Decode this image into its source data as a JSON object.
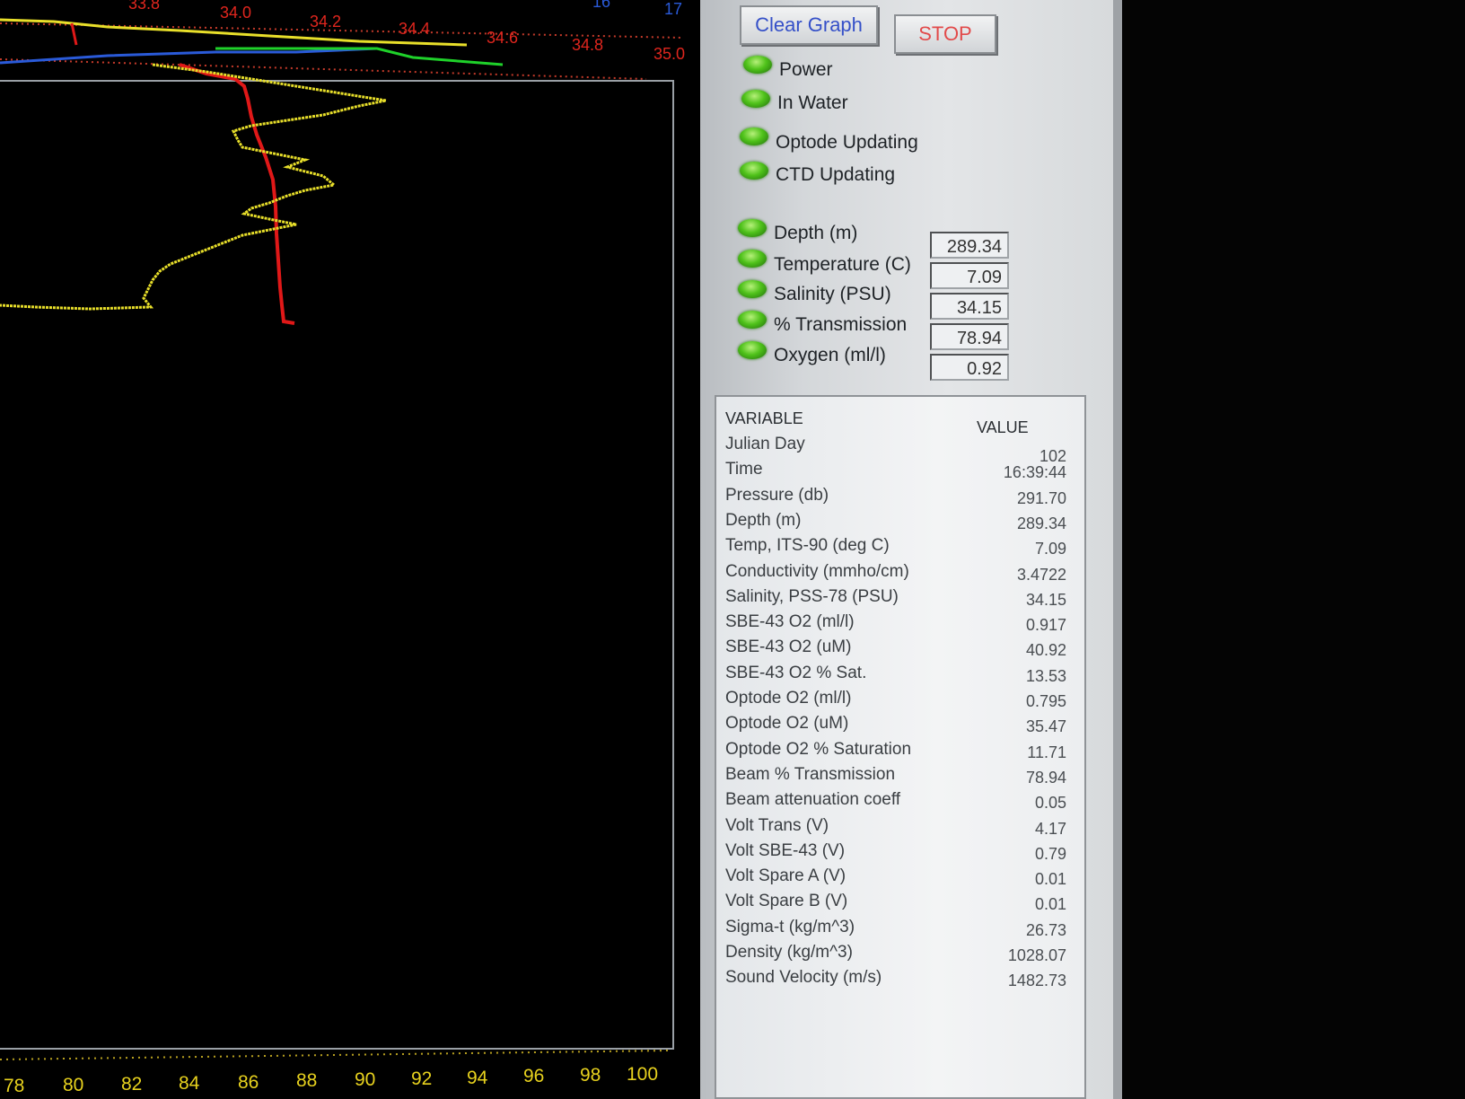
{
  "plot": {
    "top_axis_red_ticks": [
      "33.8",
      "34.0",
      "34.2",
      "34.4",
      "34.6",
      "34.8",
      "35.0"
    ],
    "top_axis_blue_ticks": [
      "16",
      "17"
    ],
    "bottom_axis_ticks": [
      "78",
      "80",
      "82",
      "84",
      "86",
      "88",
      "90",
      "92",
      "94",
      "96",
      "98",
      "100"
    ],
    "colors": {
      "salinity_trace": "#e01818",
      "transmission_trace": "#e8df2a",
      "temperature_trace": "#2a5ad8",
      "oxygen_trace": "#1fd12a",
      "top_axis_labels": "#e0261e",
      "bottom_axis_labels": "#e8d21e"
    }
  },
  "buttons": {
    "clear_graph": "Clear Graph",
    "stop": "STOP"
  },
  "indicators": [
    "Power",
    "In Water",
    "Optode Updating",
    "CTD Updating"
  ],
  "readouts": [
    {
      "label": "Depth (m)",
      "value": "289.34"
    },
    {
      "label": "Temperature (C)",
      "value": "7.09"
    },
    {
      "label": "Salinity (PSU)",
      "value": "34.15"
    },
    {
      "label": "% Transmission",
      "value": "78.94"
    },
    {
      "label": "Oxygen (ml/l)",
      "value": "0.92"
    }
  ],
  "table": {
    "header_variable": "VARIABLE",
    "header_value": "VALUE",
    "rows": [
      {
        "variable": "Julian Day",
        "value": "102"
      },
      {
        "variable": "Time",
        "value": "16:39:44"
      },
      {
        "variable": "Pressure (db)",
        "value": "291.70"
      },
      {
        "variable": "Depth (m)",
        "value": "289.34"
      },
      {
        "variable": "Temp, ITS-90 (deg C)",
        "value": "7.09"
      },
      {
        "variable": "Conductivity (mmho/cm)",
        "value": "3.4722"
      },
      {
        "variable": "Salinity, PSS-78 (PSU)",
        "value": "34.15"
      },
      {
        "variable": "SBE-43 O2 (ml/l)",
        "value": "0.917"
      },
      {
        "variable": "SBE-43 O2 (uM)",
        "value": "40.92"
      },
      {
        "variable": "SBE-43 O2 % Sat.",
        "value": "13.53"
      },
      {
        "variable": "Optode O2 (ml/l)",
        "value": "0.795"
      },
      {
        "variable": "Optode O2 (uM)",
        "value": "35.47"
      },
      {
        "variable": "Optode O2 % Saturation",
        "value": "11.71"
      },
      {
        "variable": "Beam % Transmission",
        "value": "78.94"
      },
      {
        "variable": "Beam attenuation coeff",
        "value": "0.05"
      },
      {
        "variable": "Volt Trans (V)",
        "value": "4.17"
      },
      {
        "variable": "Volt SBE-43 (V)",
        "value": "0.79"
      },
      {
        "variable": "Volt Spare A (V)",
        "value": "0.01"
      },
      {
        "variable": "Volt Spare B (V)",
        "value": "0.01"
      },
      {
        "variable": "Sigma-t (kg/m^3)",
        "value": "26.73"
      },
      {
        "variable": "Density (kg/m^3)",
        "value": "1028.07"
      },
      {
        "variable": "Sound Velocity (m/s)",
        "value": "1482.73"
      }
    ]
  }
}
